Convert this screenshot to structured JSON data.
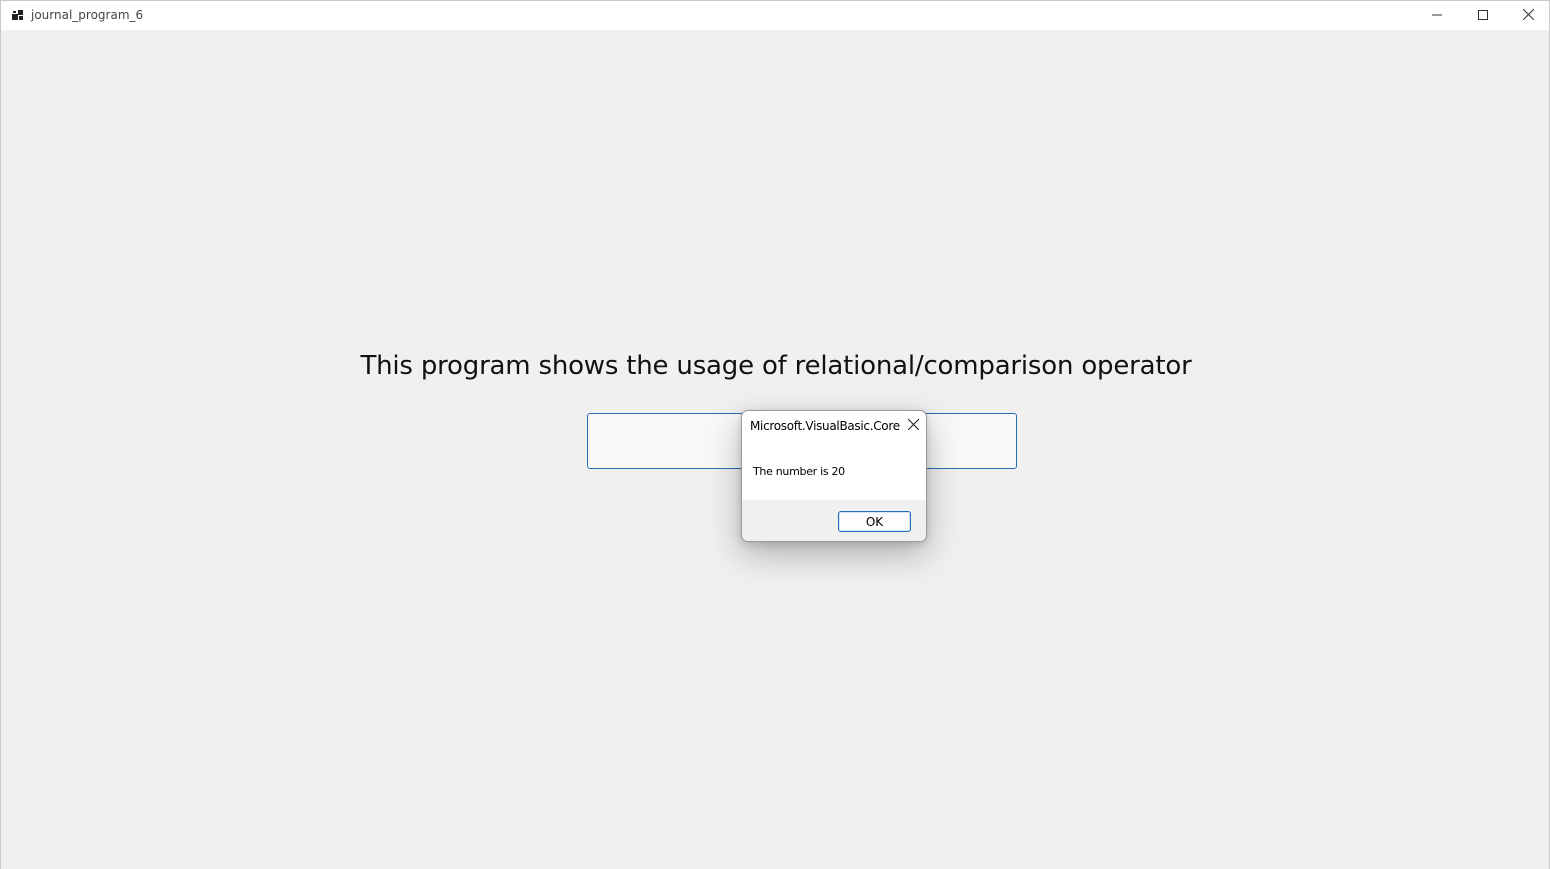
{
  "window": {
    "title": "journal_program_6",
    "controls": {
      "minimize_icon": "minimize-icon",
      "maximize_icon": "maximize-icon",
      "close_icon": "close-icon"
    }
  },
  "main": {
    "heading": "This program shows the usage of relational/comparison operator",
    "input_value": ""
  },
  "dialog": {
    "title": "Microsoft.VisualBasic.Core",
    "message": "The number is 20",
    "ok_label": "OK"
  },
  "colors": {
    "accent": "#2b6cb8",
    "background": "#f0f0f0"
  }
}
